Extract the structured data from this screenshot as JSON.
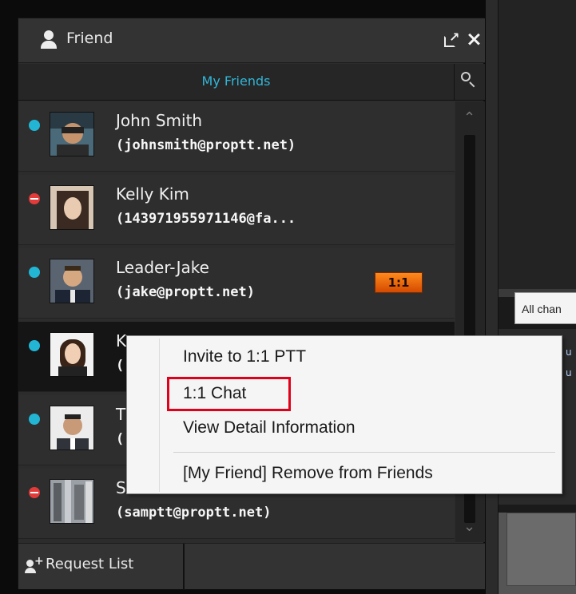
{
  "window": {
    "title": "Friend",
    "tab_label": "My Friends"
  },
  "friends": [
    {
      "name": "John Smith",
      "email": "(johnsmith@proptt.net)",
      "status": "online"
    },
    {
      "name": "Kelly Kim",
      "email": "(143971955971146@fa...",
      "status": "busy"
    },
    {
      "name": "Leader-Jake",
      "email": "(jake@proptt.net)",
      "status": "online",
      "badge": "1:1"
    },
    {
      "name": "K",
      "email": "(",
      "status": "online"
    },
    {
      "name": "T",
      "email": "(",
      "status": "online"
    },
    {
      "name": "S",
      "email": "(samptt@proptt.net)",
      "status": "busy"
    }
  ],
  "footer": {
    "request_list_label": "Request List"
  },
  "context_menu": {
    "items": [
      "Invite to 1:1 PTT",
      "1:1 Chat",
      "View Detail Information",
      "[My Friend] Remove from Friends"
    ],
    "highlighted_item": "1:1 Chat"
  },
  "background_app": {
    "channel_dropdown_label": "All chan"
  },
  "colors": {
    "accent": "#31b6d8",
    "online": "#22b6d4",
    "busy": "#e33a3a",
    "badge": "#f07a1a",
    "highlight": "#e0001a"
  }
}
